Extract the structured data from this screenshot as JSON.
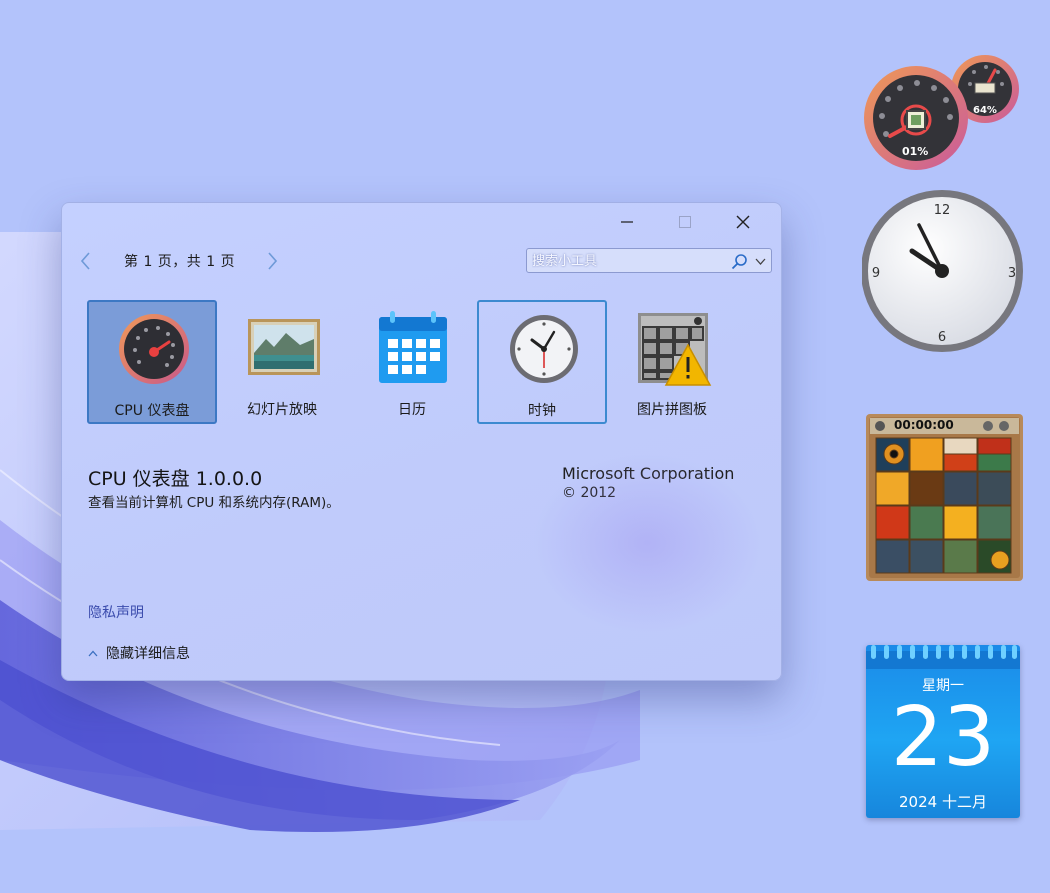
{
  "window": {
    "controls": {
      "minimize": "minimize",
      "maximize": "maximize",
      "close": "close"
    },
    "pager": {
      "text": "第 1 页，共 1 页"
    },
    "search": {
      "placeholder": "搜索小工具"
    },
    "gadgets": [
      {
        "label": "CPU 仪表盘",
        "icon": "cpu-meter-icon",
        "selected": true
      },
      {
        "label": "幻灯片放映",
        "icon": "slideshow-icon"
      },
      {
        "label": "日历",
        "icon": "calendar-icon"
      },
      {
        "label": "时钟",
        "icon": "clock-icon",
        "focused": true
      },
      {
        "label": "图片拼图板",
        "icon": "picture-puzzle-icon"
      }
    ],
    "details": {
      "title": "CPU 仪表盘 1.0.0.0",
      "description": "查看当前计算机 CPU 和系统内存(RAM)。",
      "company": "Microsoft Corporation",
      "copyright": "© 2012",
      "privacy_link": "隐私声明",
      "toggle_details": "隐藏详细信息"
    }
  },
  "desktop": {
    "cpu_meter": {
      "cpu_value": "01%",
      "ram_value": "64%"
    },
    "clock": {
      "numerals": [
        "12",
        "3",
        "6",
        "9"
      ],
      "time": "10:54"
    },
    "puzzle": {
      "timer": "00:00:00"
    },
    "calendar": {
      "weekday": "星期一",
      "day": "23",
      "month_year": "2024 十二月"
    }
  },
  "colors": {
    "desktop_bg": "#b3c3fb",
    "window_bg": "#c2cdfd",
    "selected_tile": "#7b9cd8",
    "accent": "#3c78c4",
    "link": "#3b4cad",
    "calendar_blue": "#1fa5f3",
    "meter_orange": "#e8825c"
  }
}
